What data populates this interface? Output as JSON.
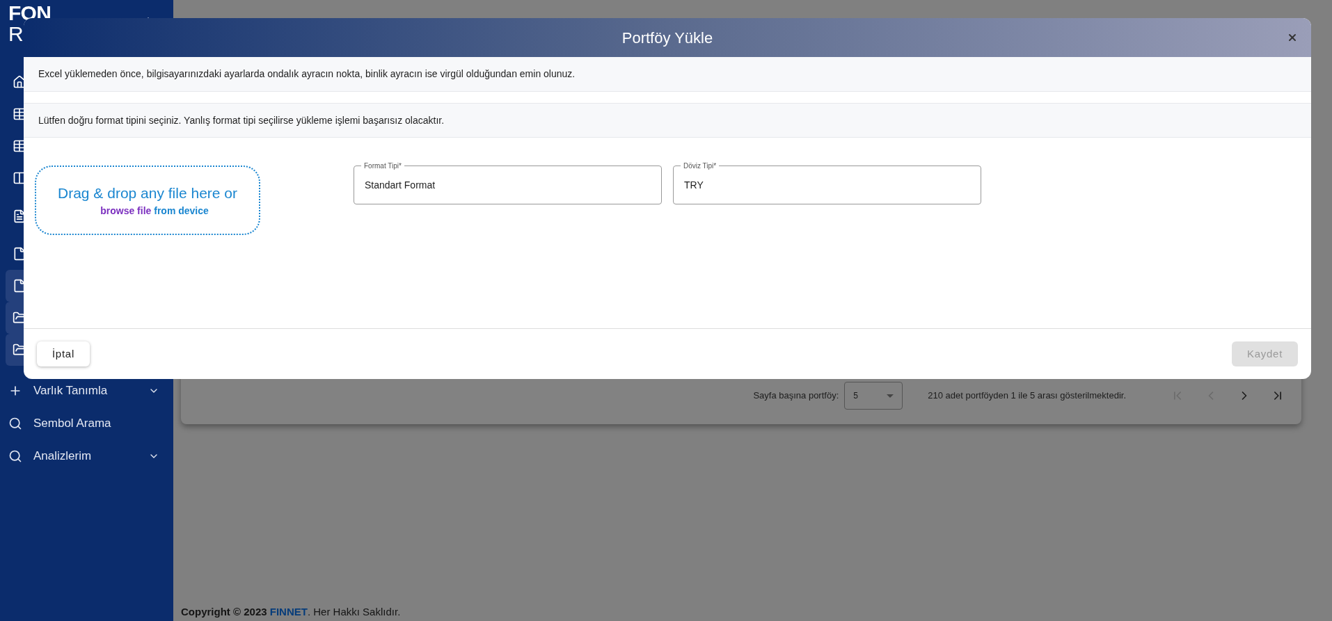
{
  "sidebar": {
    "logo_top": "FON",
    "logo_bottom": "R",
    "icon_items": [
      {
        "highlighted": false
      },
      {
        "highlighted": false
      },
      {
        "highlighted": false
      },
      {
        "highlighted": false
      },
      {
        "highlighted": false
      },
      {
        "highlighted": false
      },
      {
        "highlighted": true
      },
      {
        "highlighted": true
      },
      {
        "highlighted": true
      }
    ],
    "items": [
      {
        "label": "Varlık Tanımla",
        "expandable": true
      },
      {
        "label": "Sembol Arama",
        "expandable": false
      },
      {
        "label": "Analizlerim",
        "expandable": true
      }
    ]
  },
  "pagination": {
    "rows_label": "Sayfa başına portföy:",
    "rows_value": "5",
    "summary": "210 adet portföyden 1 ile 5 arası gösterilmektedir.",
    "buttons": [
      {
        "kind": "first",
        "disabled": true
      },
      {
        "kind": "prev",
        "disabled": true
      },
      {
        "kind": "next",
        "disabled": false
      },
      {
        "kind": "last",
        "disabled": false
      }
    ]
  },
  "footer": {
    "prefix": "Copyright © 2023",
    "brand": "FINNET",
    "suffix": ". Her Hakkı Saklıdır."
  },
  "modal": {
    "title": "Portföy Yükle",
    "notices": [
      "Excel yüklemeden önce, bilgisayarınızdaki ayarlarda ondalık ayracın nokta, binlik ayracın ise virgül olduğundan emin olunuz.",
      "Lütfen doğru format tipini seçiniz. Yanlış format tipi seçilirse yükleme işlemi başarısız olacaktır."
    ],
    "dropzone": {
      "title": "Drag & drop any file here or",
      "browse": "browse file",
      "from": "from device"
    },
    "fields": [
      {
        "label": "Format Tipi*",
        "value": "Standart Format"
      },
      {
        "label": "Döviz Tipi*",
        "value": "TRY"
      }
    ],
    "cancel": {
      "label": "İptal",
      "disabled": false
    },
    "save": {
      "label": "Kaydet",
      "disabled": true
    }
  }
}
